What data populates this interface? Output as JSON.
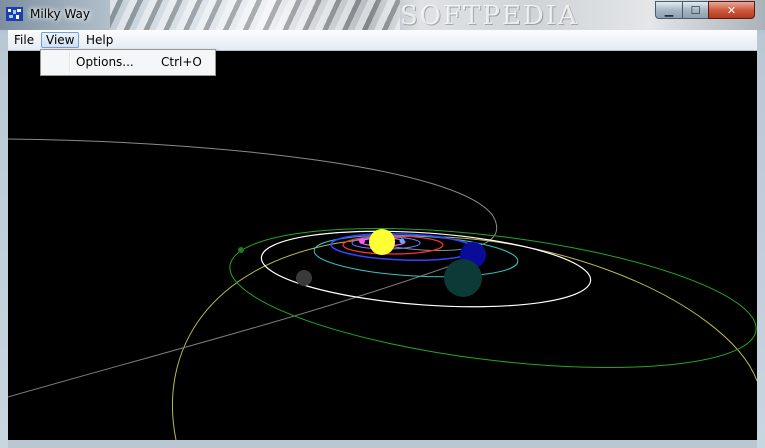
{
  "window": {
    "title": "Milky Way",
    "watermark": "SOFTPEDIA",
    "icon": "milky-way-app-icon",
    "controls": {
      "minimize_icon": "minimize-icon",
      "maximize_icon": "maximize-icon",
      "close_icon": "close-icon"
    }
  },
  "menubar": {
    "items": [
      {
        "label": "File"
      },
      {
        "label": "View",
        "open": true
      },
      {
        "label": "Help"
      }
    ]
  },
  "view_menu": {
    "items": [
      {
        "label": "Options...",
        "shortcut": "Ctrl+O"
      }
    ]
  },
  "scene": {
    "background": "#000000",
    "sun_color": "#ffff33",
    "orbit_colors": [
      "#ff66ff",
      "#6688ff",
      "#ff3333",
      "#3344ff",
      "#33cccc",
      "#ffffff",
      "#22aa22",
      "#cccc55",
      "#aaaaaa"
    ]
  }
}
